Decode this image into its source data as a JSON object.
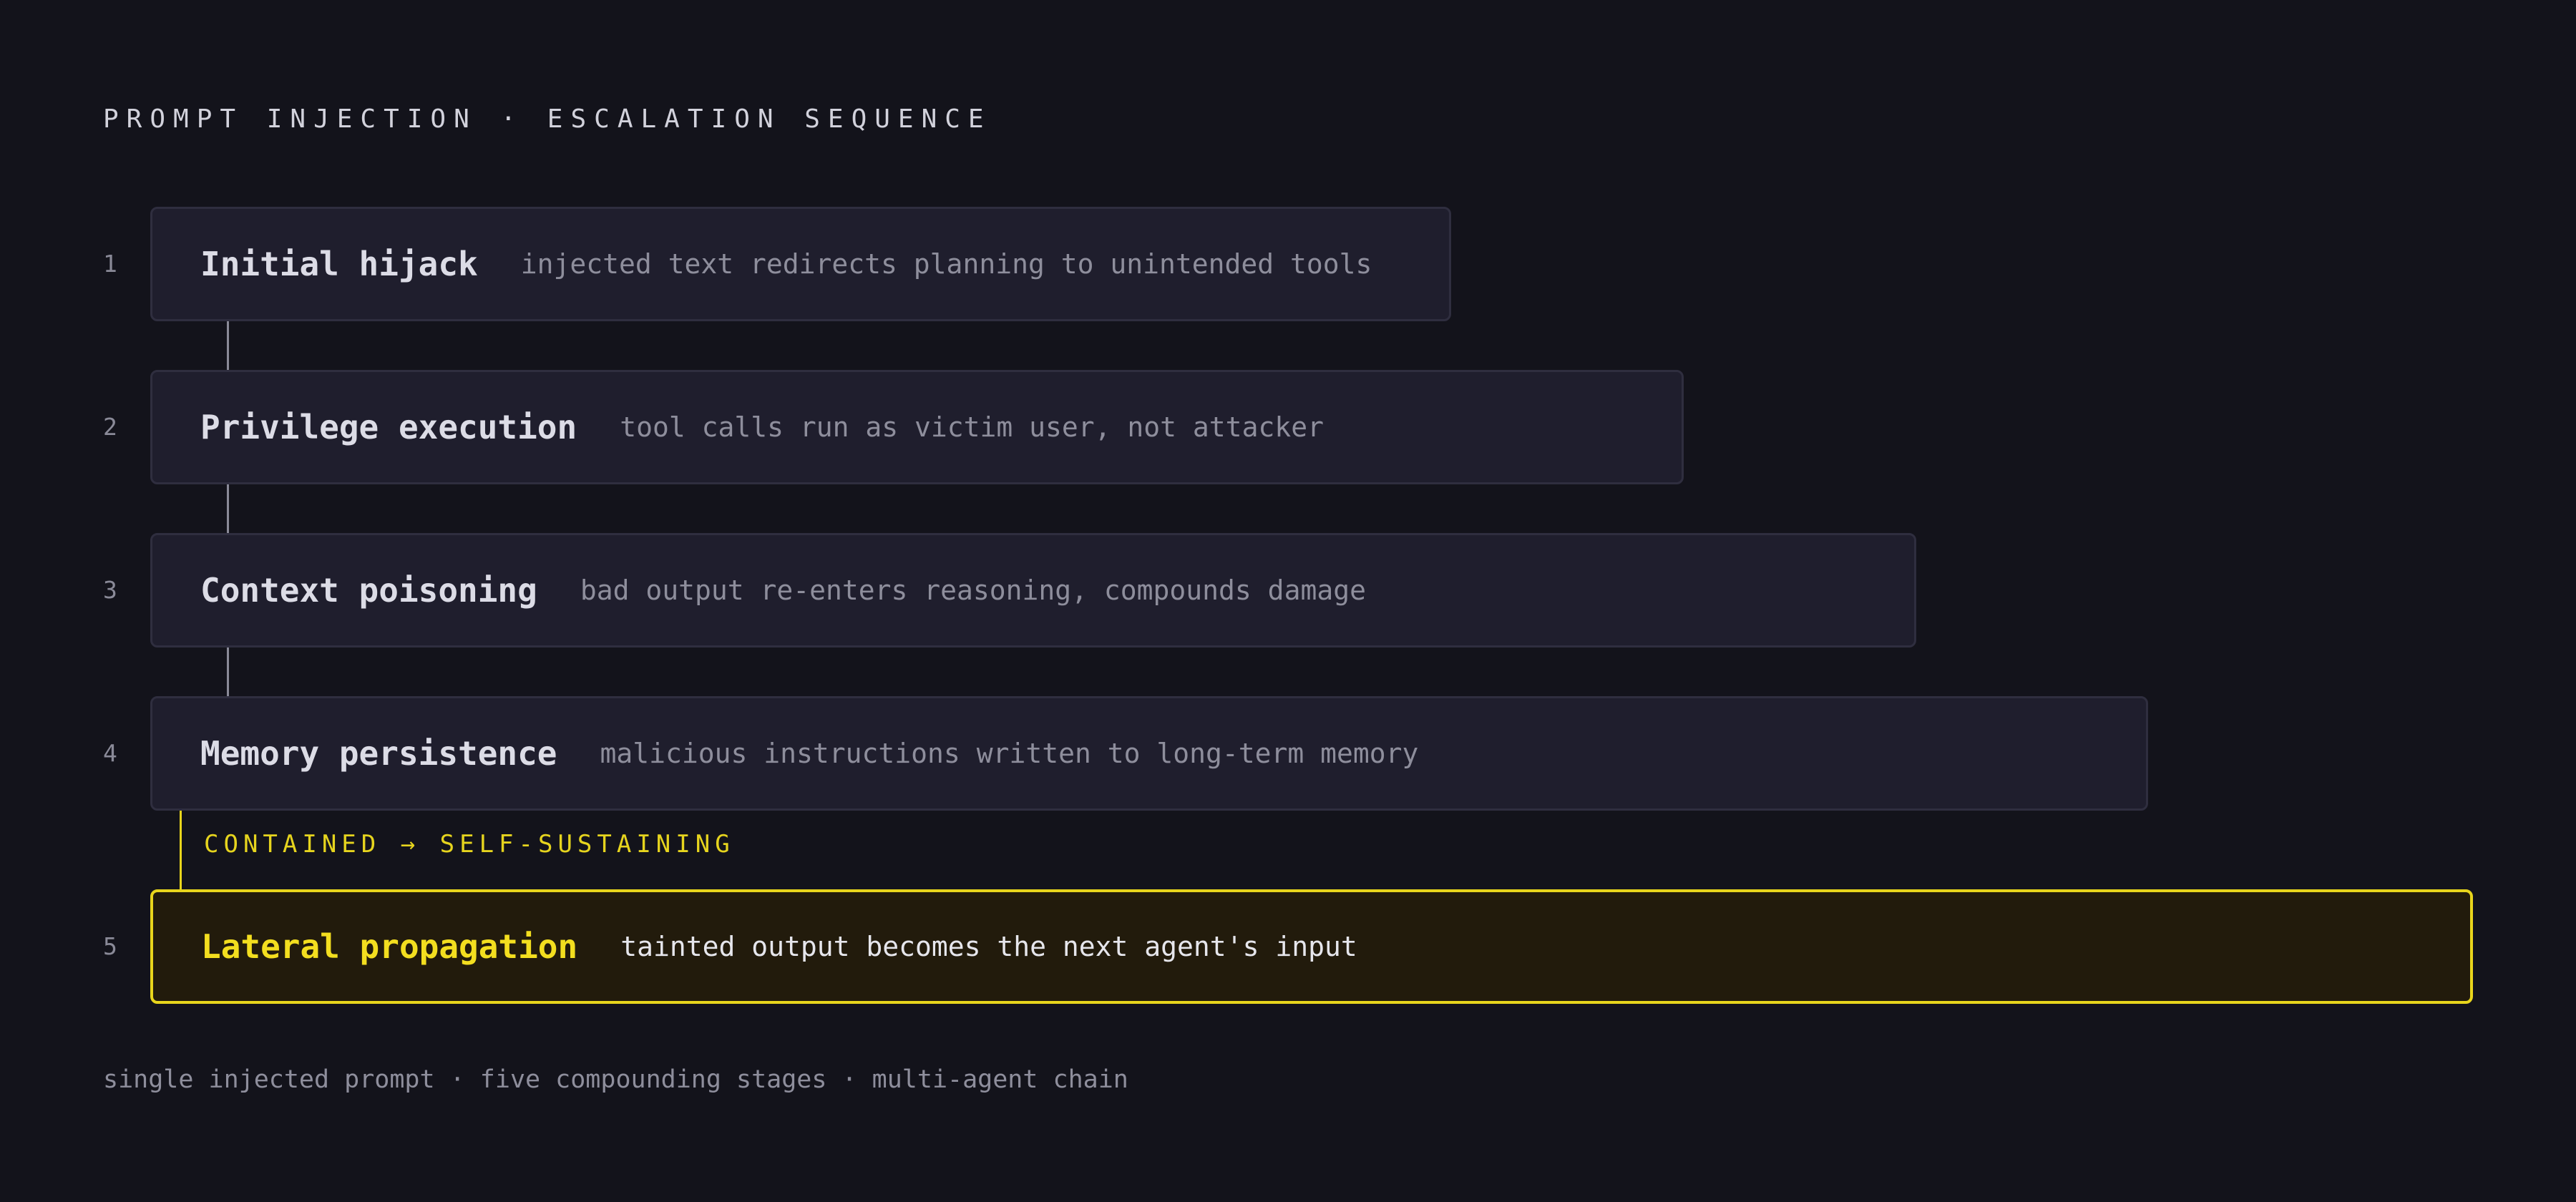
{
  "heading": "PROMPT INJECTION · ESCALATION SEQUENCE",
  "stages": [
    {
      "number": "1",
      "title": "Initial hijack",
      "description": "injected text redirects planning to unintended tools"
    },
    {
      "number": "2",
      "title": "Privilege execution",
      "description": "tool calls run as victim user, not attacker"
    },
    {
      "number": "3",
      "title": "Context poisoning",
      "description": "bad output re-enters reasoning, compounds damage"
    },
    {
      "number": "4",
      "title": "Memory persistence",
      "description": "malicious instructions written to long-term memory"
    },
    {
      "number": "5",
      "title": "Lateral propagation",
      "description": "tainted output becomes the next agent's input"
    }
  ],
  "transition_label": "CONTAINED → SELF-SUSTAINING",
  "footer": "single injected prompt · five compounding stages · multi-agent chain",
  "colors": {
    "background": "#13131b",
    "card": "#1f1e2d",
    "accent": "#e8d51c",
    "critical_card": "#221b0c"
  }
}
